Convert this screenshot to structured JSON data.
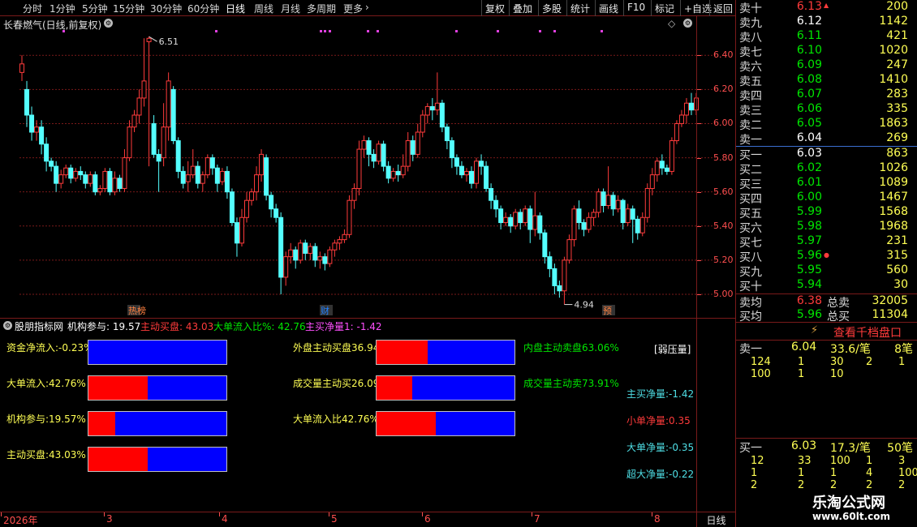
{
  "toolbar": {
    "tabs": [
      "分时",
      "1分钟",
      "5分钟",
      "15分钟",
      "30分钟",
      "60分钟",
      "日线",
      "周线",
      "月线",
      "多周期",
      "更多"
    ],
    "active": "日线",
    "right_buttons": [
      "复权",
      "叠加",
      "多股",
      "统计",
      "画线",
      "F10",
      "标记",
      "+自选",
      "返回"
    ]
  },
  "stock": {
    "title": "长春燃气(日线,前复权)"
  },
  "main_chart": {
    "high_label": "6.51",
    "low_label": "4.94",
    "y_ticks": [
      "6.40",
      "6.20",
      "6.00",
      "5.80",
      "5.60",
      "5.40",
      "5.20",
      "5.00"
    ],
    "markers": [
      "热榜",
      "财",
      "预"
    ]
  },
  "chart_data": {
    "type": "candlestick",
    "ylim": [
      4.9,
      6.62
    ],
    "y_ticks": [
      5.0,
      5.2,
      5.4,
      5.6,
      5.8,
      6.0,
      6.2,
      6.4
    ],
    "high": 6.51,
    "low": 4.94,
    "x_labels": [
      "2026年",
      "3",
      "4",
      "5",
      "6",
      "7",
      "8"
    ],
    "candles": [
      [
        6.3,
        6.35,
        6.25,
        6.4
      ],
      [
        6.2,
        6.05,
        5.98,
        6.25
      ],
      [
        6.05,
        5.95,
        5.9,
        6.1
      ],
      [
        5.95,
        5.98,
        5.9,
        6.02
      ],
      [
        5.98,
        5.88,
        5.82,
        6.02
      ],
      [
        5.88,
        5.78,
        5.72,
        5.92
      ],
      [
        5.78,
        5.75,
        5.72,
        5.8
      ],
      [
        5.75,
        5.65,
        5.6,
        5.78
      ],
      [
        5.65,
        5.7,
        5.62,
        5.73
      ],
      [
        5.7,
        5.74,
        5.68,
        5.76
      ],
      [
        5.74,
        5.68,
        5.65,
        5.76
      ],
      [
        5.68,
        5.72,
        5.66,
        5.74
      ],
      [
        5.72,
        5.7,
        5.67,
        5.75
      ],
      [
        5.7,
        5.65,
        5.62,
        5.72
      ],
      [
        5.65,
        5.7,
        5.63,
        5.72
      ],
      [
        5.7,
        5.6,
        5.58,
        5.72
      ],
      [
        5.6,
        5.62,
        5.58,
        5.64
      ],
      [
        5.62,
        5.72,
        5.6,
        5.74
      ],
      [
        5.72,
        5.6,
        5.58,
        5.74
      ],
      [
        5.6,
        5.68,
        5.58,
        5.72
      ],
      [
        5.68,
        5.62,
        5.6,
        5.7
      ],
      [
        5.62,
        5.8,
        5.6,
        5.85
      ],
      [
        5.8,
        5.98,
        5.78,
        6.02
      ],
      [
        5.98,
        6.05,
        5.95,
        6.08
      ],
      [
        6.05,
        6.15,
        6.0,
        6.2
      ],
      [
        6.15,
        6.25,
        6.1,
        6.5
      ],
      [
        6.48,
        6.5,
        5.75,
        6.51
      ],
      [
        6.0,
        5.82,
        5.8,
        6.05
      ],
      [
        5.82,
        5.78,
        5.6,
        5.85
      ],
      [
        5.8,
        5.98,
        5.75,
        6.12
      ],
      [
        5.98,
        6.25,
        5.9,
        6.3
      ],
      [
        6.2,
        5.9,
        5.88,
        6.22
      ],
      [
        5.9,
        5.72,
        5.68,
        5.92
      ],
      [
        5.72,
        5.65,
        5.62,
        5.75
      ],
      [
        5.66,
        5.7,
        5.6,
        5.78
      ],
      [
        5.7,
        5.75,
        5.68,
        5.85
      ],
      [
        5.75,
        5.65,
        5.62,
        5.78
      ],
      [
        5.65,
        5.7,
        5.6,
        5.72
      ],
      [
        5.7,
        5.8,
        5.68,
        5.82
      ],
      [
        5.8,
        5.74,
        5.7,
        5.82
      ],
      [
        5.74,
        5.65,
        5.6,
        5.76
      ],
      [
        5.66,
        5.72,
        5.64,
        5.74
      ],
      [
        5.72,
        5.6,
        5.56,
        5.75
      ],
      [
        5.6,
        5.42,
        5.4,
        5.62
      ],
      [
        5.42,
        5.3,
        5.22,
        5.45
      ],
      [
        5.3,
        5.45,
        5.28,
        5.5
      ],
      [
        5.45,
        5.55,
        5.42,
        5.6
      ],
      [
        5.55,
        5.6,
        5.52,
        5.62
      ],
      [
        5.6,
        5.7,
        5.55,
        5.75
      ],
      [
        5.7,
        5.82,
        5.66,
        5.85
      ],
      [
        5.8,
        5.58,
        5.55,
        5.82
      ],
      [
        5.58,
        5.5,
        5.45,
        5.6
      ],
      [
        5.5,
        5.45,
        5.42,
        5.53
      ],
      [
        5.45,
        5.1,
        5.0,
        5.48
      ],
      [
        5.1,
        5.22,
        5.05,
        5.25
      ],
      [
        5.22,
        5.26,
        5.18,
        5.3
      ],
      [
        5.26,
        5.2,
        5.15,
        5.28
      ],
      [
        5.2,
        5.3,
        5.18,
        5.32
      ],
      [
        5.3,
        5.24,
        5.2,
        5.32
      ],
      [
        5.24,
        5.28,
        5.2,
        5.3
      ],
      [
        5.28,
        5.2,
        5.16,
        5.3
      ],
      [
        5.2,
        5.22,
        5.15,
        5.25
      ],
      [
        5.22,
        5.18,
        5.14,
        5.24
      ],
      [
        5.18,
        5.26,
        5.16,
        5.28
      ],
      [
        5.26,
        5.3,
        5.22,
        5.32
      ],
      [
        5.3,
        5.32,
        5.26,
        5.34
      ],
      [
        5.32,
        5.35,
        5.3,
        5.38
      ],
      [
        5.35,
        5.55,
        5.33,
        5.58
      ],
      [
        5.55,
        5.62,
        5.5,
        5.65
      ],
      [
        5.62,
        5.85,
        5.58,
        5.9
      ],
      [
        5.85,
        5.9,
        5.8,
        5.93
      ],
      [
        5.9,
        5.82,
        5.75,
        5.92
      ],
      [
        5.82,
        5.78,
        5.74,
        5.85
      ],
      [
        5.78,
        5.88,
        5.76,
        5.9
      ],
      [
        5.88,
        5.75,
        5.72,
        5.9
      ],
      [
        5.75,
        5.68,
        5.65,
        5.78
      ],
      [
        5.68,
        5.72,
        5.66,
        5.74
      ],
      [
        5.72,
        5.7,
        5.66,
        5.76
      ],
      [
        5.7,
        5.75,
        5.68,
        5.82
      ],
      [
        5.75,
        5.9,
        5.72,
        5.95
      ],
      [
        5.9,
        5.82,
        5.78,
        5.93
      ],
      [
        5.82,
        5.95,
        5.8,
        6.0
      ],
      [
        5.95,
        6.05,
        5.92,
        6.08
      ],
      [
        6.05,
        6.1,
        6.0,
        6.12
      ],
      [
        6.1,
        6.08,
        6.02,
        6.15
      ],
      [
        6.08,
        6.12,
        6.05,
        6.3
      ],
      [
        6.12,
        5.98,
        5.95,
        6.14
      ],
      [
        5.98,
        5.9,
        5.85,
        6.0
      ],
      [
        5.9,
        5.8,
        5.74,
        5.92
      ],
      [
        5.8,
        5.75,
        5.7,
        5.82
      ],
      [
        5.75,
        5.7,
        5.68,
        5.78
      ],
      [
        5.7,
        5.72,
        5.66,
        5.74
      ],
      [
        5.72,
        5.65,
        5.62,
        5.75
      ],
      [
        5.65,
        5.78,
        5.62,
        5.8
      ],
      [
        5.78,
        5.75,
        5.7,
        5.82
      ],
      [
        5.75,
        5.62,
        5.6,
        5.78
      ],
      [
        5.62,
        5.55,
        5.5,
        5.65
      ],
      [
        5.55,
        5.5,
        5.45,
        5.58
      ],
      [
        5.5,
        5.42,
        5.38,
        5.52
      ],
      [
        5.42,
        5.45,
        5.4,
        5.48
      ],
      [
        5.45,
        5.4,
        5.36,
        5.47
      ],
      [
        5.4,
        5.48,
        5.38,
        5.5
      ],
      [
        5.48,
        5.42,
        5.38,
        5.5
      ],
      [
        5.42,
        5.5,
        5.4,
        5.52
      ],
      [
        5.5,
        5.38,
        5.3,
        5.52
      ],
      [
        5.38,
        5.46,
        5.34,
        5.6
      ],
      [
        5.46,
        5.36,
        5.32,
        5.48
      ],
      [
        5.36,
        5.22,
        5.18,
        5.38
      ],
      [
        5.22,
        5.15,
        5.1,
        5.25
      ],
      [
        5.15,
        5.05,
        5.0,
        5.18
      ],
      [
        5.05,
        5.02,
        4.98,
        5.08
      ],
      [
        5.02,
        5.2,
        4.94,
        5.22
      ],
      [
        5.2,
        5.32,
        5.18,
        5.35
      ],
      [
        5.32,
        5.5,
        5.28,
        5.52
      ],
      [
        5.5,
        5.42,
        5.38,
        5.55
      ],
      [
        5.42,
        5.38,
        5.34,
        5.44
      ],
      [
        5.38,
        5.45,
        5.36,
        5.48
      ],
      [
        5.45,
        5.48,
        5.4,
        5.5
      ],
      [
        5.48,
        5.6,
        5.45,
        5.62
      ],
      [
        5.6,
        5.52,
        5.48,
        5.62
      ],
      [
        5.52,
        5.58,
        5.5,
        5.75
      ],
      [
        5.58,
        5.5,
        5.46,
        5.6
      ],
      [
        5.5,
        5.55,
        5.48,
        5.58
      ],
      [
        5.55,
        5.42,
        5.38,
        5.56
      ],
      [
        5.42,
        5.5,
        5.4,
        5.53
      ],
      [
        5.5,
        5.44,
        5.3,
        5.52
      ],
      [
        5.44,
        5.36,
        5.32,
        5.46
      ],
      [
        5.36,
        5.45,
        5.34,
        5.48
      ],
      [
        5.45,
        5.62,
        5.42,
        5.65
      ],
      [
        5.62,
        5.7,
        5.58,
        5.74
      ],
      [
        5.7,
        5.78,
        5.66,
        5.8
      ],
      [
        5.78,
        5.74,
        5.7,
        5.82
      ],
      [
        5.74,
        5.72,
        5.7,
        5.76
      ],
      [
        5.72,
        5.9,
        5.7,
        5.92
      ],
      [
        5.9,
        6.0,
        5.88,
        6.02
      ],
      [
        6.0,
        6.05,
        5.98,
        6.08
      ],
      [
        6.05,
        6.12,
        6.0,
        6.15
      ],
      [
        6.12,
        6.08,
        6.05,
        6.18
      ],
      [
        6.08,
        6.15,
        6.05,
        6.18
      ]
    ]
  },
  "indicator": {
    "title": "股朋指标网",
    "values": [
      "机构参与: 19.57",
      "主动买盘: 43.03",
      "大单流入比%: 42.76",
      "主买净量1: -1.42"
    ],
    "left_rows": [
      {
        "label": "资金净流入:-0.23%",
        "fraction": 0.0
      },
      {
        "label": "大单流入:42.76%",
        "fraction": 0.4276
      },
      {
        "label": "机构参与:19.57%",
        "fraction": 0.1957
      },
      {
        "label": "主动买盘:43.03%",
        "fraction": 0.4303
      }
    ],
    "mid_rows": [
      {
        "label": "外盘主动买盘36.94%",
        "fraction": 0.3694
      },
      {
        "label": "成交量主动买26.09%",
        "fraction": 0.2609
      },
      {
        "label": "大单流入比42.76%",
        "fraction": 0.4276
      }
    ],
    "right_labels": [
      "内盘主动卖盘63.06%",
      "成交量主动卖73.91%"
    ],
    "pressure": "[弱压量]",
    "net": [
      "主买净量:-1.42",
      "小单净量:0.35",
      "大单净量:-0.35",
      "超大净量:-0.22"
    ]
  },
  "dates": [
    "2026年",
    "3",
    "4",
    "5",
    "6",
    "7",
    "8"
  ],
  "bottom_tab": "日线",
  "orderbook": {
    "asks": [
      [
        "卖十",
        "6.13",
        "200"
      ],
      [
        "卖九",
        "6.12",
        "1142"
      ],
      [
        "卖八",
        "6.11",
        "421"
      ],
      [
        "卖七",
        "6.10",
        "1020"
      ],
      [
        "卖六",
        "6.09",
        "247"
      ],
      [
        "卖五",
        "6.08",
        "1410"
      ],
      [
        "卖四",
        "6.07",
        "283"
      ],
      [
        "卖三",
        "6.06",
        "335"
      ],
      [
        "卖二",
        "6.05",
        "1863"
      ],
      [
        "卖一",
        "6.04",
        "269"
      ]
    ],
    "bids": [
      [
        "买一",
        "6.03",
        "863"
      ],
      [
        "买二",
        "6.02",
        "1026"
      ],
      [
        "买三",
        "6.01",
        "1089"
      ],
      [
        "买四",
        "6.00",
        "1467"
      ],
      [
        "买五",
        "5.99",
        "1568"
      ],
      [
        "买六",
        "5.98",
        "1968"
      ],
      [
        "买七",
        "5.97",
        "231"
      ],
      [
        "买八",
        "5.96",
        "315"
      ],
      [
        "买九",
        "5.95",
        "560"
      ],
      [
        "买十",
        "5.94",
        "30"
      ]
    ],
    "avg_sell": [
      "卖均",
      "6.38",
      "总卖",
      "32005"
    ],
    "avg_buy": [
      "买均",
      "5.96",
      "总买",
      "11304"
    ],
    "link": "查看千档盘口",
    "sell1": {
      "label": "卖一",
      "price": "6.04",
      "per": "33.6/笔",
      "count": "8笔",
      "queue": [
        [
          "124",
          "1",
          "30",
          "2",
          "1"
        ],
        [
          "100",
          "1",
          "10",
          "",
          ""
        ]
      ]
    },
    "buy1": {
      "label": "买一",
      "price": "6.03",
      "per": "17.3/笔",
      "count": "50笔",
      "queue": [
        [
          "12",
          "33",
          "100",
          "1",
          "3"
        ],
        [
          "1",
          "1",
          "1",
          "4",
          "100"
        ],
        [
          "2",
          "2",
          "2",
          "2",
          "2"
        ]
      ]
    },
    "watermark": [
      "乐淘公式网",
      "www.60lt.com"
    ]
  }
}
